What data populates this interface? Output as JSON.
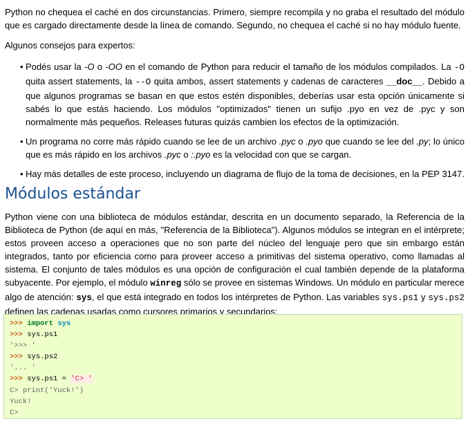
{
  "intro": {
    "text": "Python no chequea el caché en dos circunstancias. Primero, siempre recompila y no graba el resultado del módulo que es cargado directamente desde la línea de comando. Segundo, no chequea el caché si no hay módulo fuente."
  },
  "tips_heading": "Algunos consejos para expertos:",
  "tips": {
    "bullet": "•",
    "t1": {
      "a": "Podés usar la ",
      "b": "-O",
      "c": " o ",
      "d": "-OO",
      "e": " en el comando de Python para reducir el tamaño de los módulos compilados. La ",
      "f": "-O",
      "g": " quita assert statements, la ",
      "h": "--O",
      "i": " quita ambos, assert statements y cadenas de caracteres ",
      "j": "__doc__",
      "k": ". Debido a que algunos programas se basan en que estos estén disponibles, deberías usar esta opción únicamente si sabés lo que estás haciendo. Los módulos \"optimizados\" tienen un sufijo .pyo en vez de .pyc y son normalmente más pequeños. Releases futuras quizás cambien los efectos de la optimización."
    },
    "t2": {
      "a": "Un programa no corre más rápido cuando se lee de un archivo ",
      "b": ".pyc",
      "c": " o ",
      "d": ".pyo",
      "e": " que cuando se lee del ",
      "f": ".py",
      "g": "; lo único que es más rápido en los archivos ",
      "h": ".pyc",
      "i": " o ",
      "j": ":.pyo",
      "k": " es la velocidad con que se cargan."
    },
    "t3": "Hay más detalles de este proceso, incluyendo un diagrama de flujo de la toma de decisiones, en la PEP 3147."
  },
  "section": {
    "title": "Módulos estándar",
    "p": {
      "a": "Python viene con una biblioteca de módulos estándar, descrita en un documento separado, la Referencia de la Biblioteca de Python (de aquí en más, \"Referencia de la Biblioteca\"). Algunos módulos se integran en el intérprete; estos proveen acceso a operaciones que no son parte del núcleo del lenguaje pero que sin embargo están integrados, tanto por eficiencia como para proveer acceso a primitivas del sistema operativo, como llamadas al sistema. El conjunto de tales módulos es una opción de configuración el cual también depende de la plataforma subyacente. Por ejemplo, el módulo ",
      "b": "winreg",
      "c": " sólo se provee en sistemas Windows. Un módulo en particular merece algo de atención: ",
      "d": "sys",
      "e": ", el que está integrado en todos los intérpretes de Python. Las variables ",
      "f": "sys.ps1",
      "g": " y ",
      "h": "sys.ps2",
      "i": " definen las cadenas usadas como cursores primarios y secundarios:"
    }
  },
  "code": {
    "prompt": ">>>",
    "l1_kw": "import",
    "l1_mod": "sys",
    "l2": "sys.ps1",
    "l3": "'>>> '",
    "l4": "sys.ps2",
    "l5": "'... '",
    "l6_a": "sys.ps1 = ",
    "l6_b": "'C> '",
    "l7": "C> print('Yuck!')",
    "l8": "Yuck!",
    "l9": "C>"
  }
}
